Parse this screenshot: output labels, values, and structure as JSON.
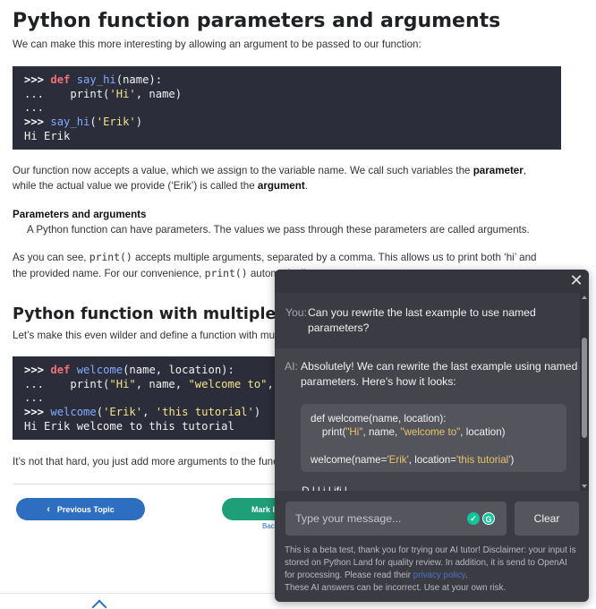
{
  "article": {
    "heading1": "Python function parameters and arguments",
    "intro": "We can make this more interesting by allowing an argument to be passed to our function:",
    "code1": {
      "l1_prompt": ">>>",
      "l1_kw": "def",
      "l1_fn": "say_hi",
      "l1_rest": "(name):",
      "l2_prompt": "...",
      "l2_code": "    print(",
      "l2_str": "'Hi'",
      "l2_rest": ", name)",
      "l3_prompt": "...",
      "l4_prompt": ">>>",
      "l4_fn": "say_hi",
      "l4_open": "(",
      "l4_str": "'Erik'",
      "l4_close": ")",
      "l5_out": "Hi Erik"
    },
    "para2_a": "Our function now accepts a value, which we assign to the variable name. We call such variables the ",
    "para2_bold1": "parameter",
    "para2_b": ", while the actual value we provide (‘Erik’) is called the ",
    "para2_bold2": "argument",
    "para2_c": ".",
    "def_title": "Parameters and arguments",
    "def_body": "A Python function can have parameters. The values we pass through these parameters are called arguments.",
    "para3_a": "As you can see, ",
    "para3_code1": "print()",
    "para3_b": " accepts multiple arguments, separated by a comma. This allows us to print both ‘hi’ and the provided name. For our convenience, ",
    "para3_code2": "print()",
    "para3_c": " automatically puts a spa",
    "heading2": "Python function with multiple argument",
    "para4": "Let’s make this even wilder and define a function with multiple",
    "code2": {
      "l1_prompt": ">>>",
      "l1_kw": "def",
      "l1_fn": "welcome",
      "l1_rest": "(name, location):",
      "l2_prompt": "...",
      "l2_code": "    print(",
      "l2_str1": "\"Hi\"",
      "l2_mid": ", name, ",
      "l2_str2": "\"welcome to\"",
      "l2_rest": ", l",
      "l3_prompt": "...",
      "l4_prompt": ">>>",
      "l4_fn": "welcome",
      "l4_open": "(",
      "l4_str1": "'Erik'",
      "l4_comma": ", ",
      "l4_str2": "'this tutorial'",
      "l4_close": ")",
      "l5_out": "Hi Erik welcome to this tutorial"
    },
    "para5": "It’s not that hard, you just add more arguments to the function"
  },
  "nav": {
    "prev_label": "Previous Topic",
    "mark_label": "Mark I",
    "back_label": "Bac"
  },
  "chat": {
    "close_symbol": "✕",
    "you_label": "You:",
    "you_text_1": "Can you rewrite the last example to use named",
    "you_text_2": "parameters?",
    "ai_label": "AI:",
    "ai_text_1": "Absolutely! We can rewrite the last example using named",
    "ai_text_2": "parameters. Here's how it looks:",
    "code_l1": "def welcome(name, location):",
    "code_l2_a": "    print(",
    "code_l2_s1": "\"Hi\"",
    "code_l2_b": ", name, ",
    "code_l2_s2": "\"welcome to\"",
    "code_l2_c": ", location)",
    "code_l4_a": "welcome(name=",
    "code_l4_s1": "'Erik'",
    "code_l4_b": ", location=",
    "code_l4_s2": "'this tutorial'",
    "code_l4_c": ")",
    "cutoff_text": "D                                          l l       i      l          ifi  l",
    "input_placeholder": "Type your message...",
    "clear_label": "Clear",
    "disclaimer_1": "This is a beta test, thank you for trying our AI tutor! Disclaimer: your input is stored on Python Land for quality review. In addition, it is send to OpenAI for processing. Please read their ",
    "disclaimer_link": "privacy policy",
    "disclaimer_2": ".",
    "disclaimer_3": "These AI answers can be incorrect. Use at your own risk."
  }
}
